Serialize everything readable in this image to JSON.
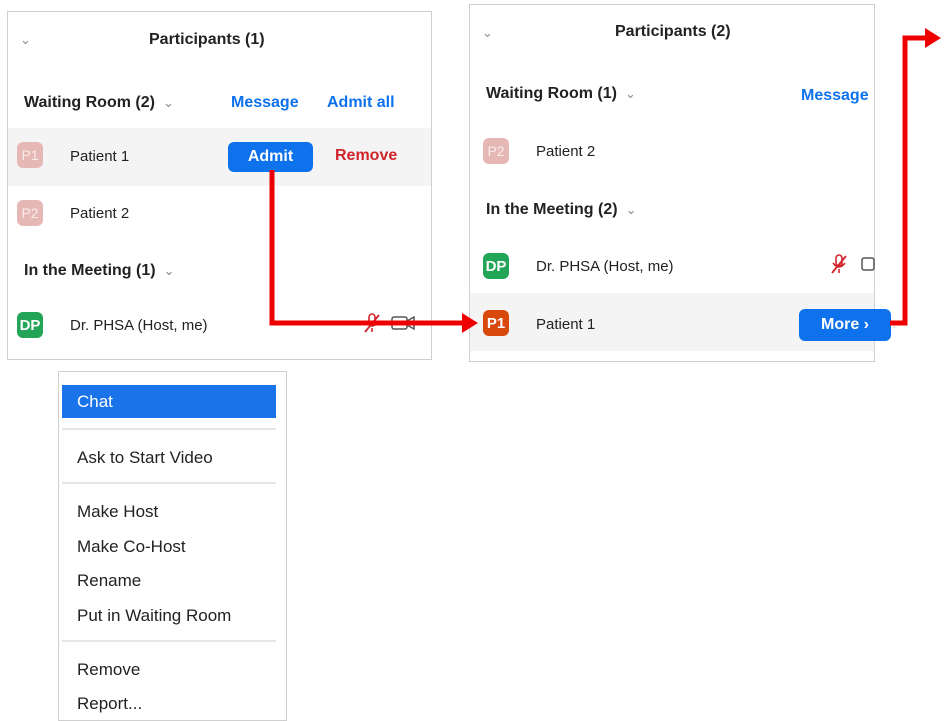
{
  "left_panel": {
    "title": "Participants (1)",
    "waiting_room": {
      "label": "Waiting Room (2)",
      "message": "Message",
      "admit_all": "Admit all"
    },
    "patients": [
      {
        "initials": "P1",
        "name": "Patient 1",
        "admit": "Admit",
        "remove": "Remove"
      },
      {
        "initials": "P2",
        "name": "Patient 2"
      }
    ],
    "in_meeting": {
      "label": "In the Meeting (1)"
    },
    "host": {
      "initials": "DP",
      "name": "Dr. PHSA (Host, me)"
    }
  },
  "right_panel": {
    "title": "Participants (2)",
    "waiting_room": {
      "label": "Waiting Room (1)",
      "message": "Message"
    },
    "patients": [
      {
        "initials": "P2",
        "name": "Patient 2"
      }
    ],
    "in_meeting": {
      "label": "In the Meeting (2)"
    },
    "host": {
      "initials": "DP",
      "name": "Dr. PHSA (Host, me)"
    },
    "attendee": {
      "initials": "P1",
      "name": "Patient 1",
      "more": "More ›"
    }
  },
  "context_menu": {
    "items": [
      "Chat",
      "Ask to Start Video",
      "Make Host",
      "Make Co-Host",
      "Rename",
      "Put in Waiting Room",
      "Remove",
      "Report..."
    ]
  },
  "icons": {
    "chevron": "chevron-down-icon",
    "mute": "muted-mic-icon",
    "video": "video-camera-icon"
  },
  "colors": {
    "accent_blue": "#0e72ed",
    "remove_red": "#d0242b",
    "arrow_red": "#ee0000",
    "host_green": "#23a558",
    "patient_orange": "#d9490c",
    "pending_pink": "#e5b8b6"
  }
}
